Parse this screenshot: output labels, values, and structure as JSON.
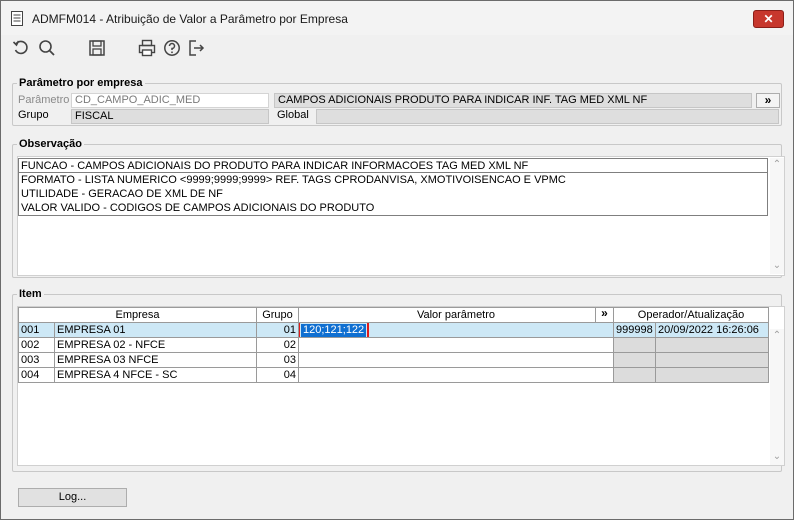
{
  "window": {
    "title": "ADMFM014 - Atribuição de Valor a Parâmetro por Empresa",
    "close_label": "✕"
  },
  "toolbar": {
    "icons": [
      "undo-icon",
      "search-icon",
      "save-icon",
      "print-icon",
      "help-icon",
      "exit-icon"
    ]
  },
  "parametro_section": {
    "legend": "Parâmetro por empresa",
    "parametro_label": "Parâmetro",
    "parametro_value": "CD_CAMPO_ADIC_MED",
    "parametro_desc": "CAMPOS ADICIONAIS PRODUTO PARA INDICAR INF. TAG MED XML NF",
    "expand_label": "»",
    "grupo_label": "Grupo",
    "grupo_value": "FISCAL",
    "global_label": "Global",
    "global_value": ""
  },
  "observacao_section": {
    "legend": "Observação",
    "lines": [
      "FUNCAO - CAMPOS ADICIONAIS DO PRODUTO PARA INDICAR INFORMACOES TAG MED XML NF",
      "FORMATO - LISTA NUMERICO <9999;9999;9999> REF. TAGS CPRODANVISA, XMOTIVOISENCAO E VPMC",
      "UTILIDADE - GERACAO DE XML DE NF",
      "VALOR VALIDO - CODIGOS DE CAMPOS ADICIONAIS DO PRODUTO"
    ]
  },
  "item_section": {
    "legend": "Item",
    "headers": {
      "empresa": "Empresa",
      "grupo": "Grupo",
      "valor": "Valor parâmetro",
      "valor_expand": "»",
      "operador": "Operador/Atualização"
    },
    "rows": [
      {
        "codigo": "001",
        "empresa": "EMPRESA 01",
        "grupo": "01",
        "valor": "120;121;122",
        "operador": "999998",
        "atualizacao": "20/09/2022 16:26:06"
      },
      {
        "codigo": "002",
        "empresa": "EMPRESA 02 - NFCE",
        "grupo": "02",
        "valor": "",
        "operador": "",
        "atualizacao": ""
      },
      {
        "codigo": "003",
        "empresa": "EMPRESA 03 NFCE",
        "grupo": "03",
        "valor": "",
        "operador": "",
        "atualizacao": ""
      },
      {
        "codigo": "004",
        "empresa": "EMPRESA 4 NFCE - SC",
        "grupo": "04",
        "valor": "",
        "operador": "",
        "atualizacao": ""
      }
    ]
  },
  "footer": {
    "log_button": "Log..."
  }
}
